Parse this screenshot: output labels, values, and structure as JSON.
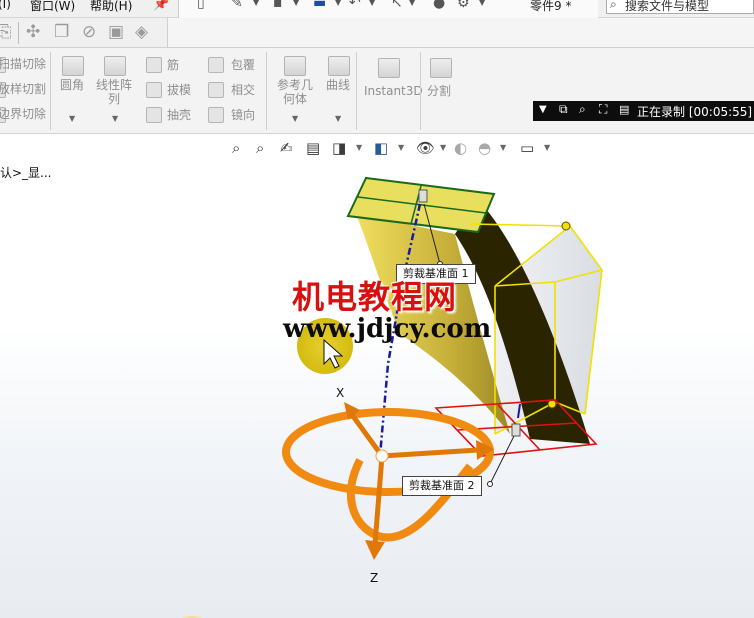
{
  "menu": {
    "items": [
      "(I)",
      "窗口(W)",
      "帮助(H)"
    ],
    "document_name": "零件9 *",
    "search_placeholder": "搜索文件与模型"
  },
  "ribbon": {
    "left_col": [
      "扫描切除",
      "放样切割",
      "边界切除"
    ],
    "fillet": "圆角",
    "linear_pattern": "线性阵\n列",
    "rib": "筋",
    "draft": "拔模",
    "shell": "抽壳",
    "wrap": "包覆",
    "intersect": "相交",
    "mirror": "镜向",
    "ref_geometry": "参考几\n何体",
    "curves": "曲线",
    "instant3d": "Instant3D",
    "split": "分割"
  },
  "recording": {
    "status": "正在录制",
    "time": "[00:05:55]"
  },
  "viewport": {
    "breadcrumb": "认>_显...",
    "plane1_label": "剪裁基准面 1",
    "plane2_label": "剪裁基准面 2",
    "axis_x": "X",
    "axis_z": "Z"
  },
  "watermark": {
    "chinese": "机电教程网",
    "url": "www.jdjcy.com"
  },
  "colors": {
    "model_yellow": "#e8d44d",
    "model_dark": "#2a2400",
    "selection_yellow": "#f2e000",
    "plane_red": "#e01010",
    "triad_orange": "#f08a10",
    "watermark_red": "#d81010",
    "record_bar": "#0d0d0d"
  }
}
